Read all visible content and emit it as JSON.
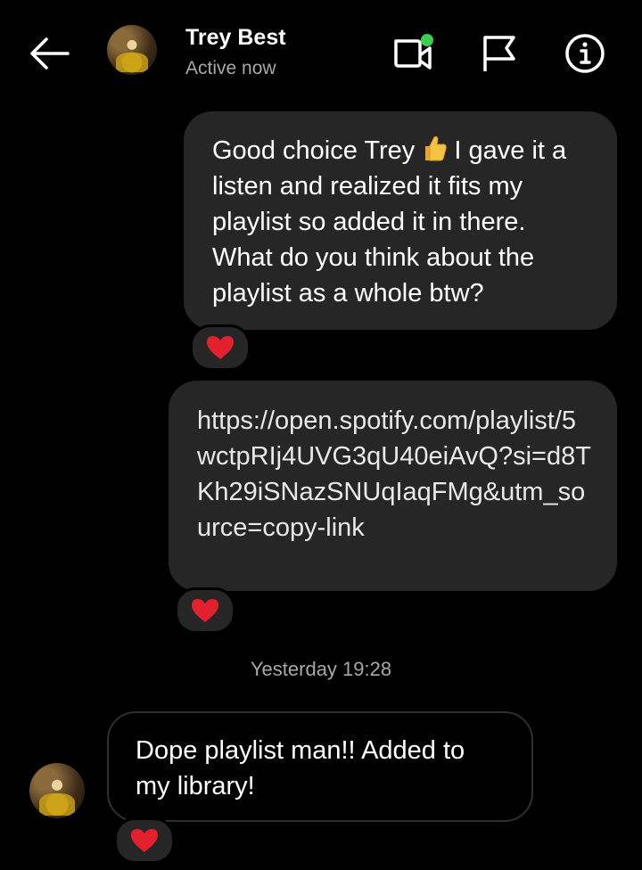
{
  "header": {
    "contact_name": "Trey Best",
    "status": "Active now",
    "active_indicator_color": "#3ccf4e"
  },
  "icons": {
    "back": "arrow-left-icon",
    "video": "video-call-icon",
    "flag": "flag-icon",
    "info": "info-icon",
    "reaction": "red-heart-icon",
    "thumb": "thumbs-up-emoji"
  },
  "messages": [
    {
      "direction": "sent",
      "text_before_emoji": "Good choice Trey ",
      "emoji": "thumbs-up",
      "text_after_emoji": " I gave it a listen and realized it fits my playlist so added it in there. What do you think about the playlist as a whole btw?",
      "reaction": "heart"
    },
    {
      "direction": "sent",
      "text": "https://open.spotify.com/playlist/5wctpRIj4UVG3qU40eiAvQ?si=d8TKh29iSNazSNUqIaqFMg&utm_source=copy-link",
      "reaction": "heart"
    },
    {
      "direction": "received",
      "text": "Dope playlist man!! Added to my library!",
      "reaction": "heart"
    }
  ],
  "timestamp": "Yesterday 19:28",
  "colors": {
    "background": "#000000",
    "sent_bubble": "#262626",
    "heart": "#e3202e",
    "secondary_text": "#a8a8a8"
  }
}
